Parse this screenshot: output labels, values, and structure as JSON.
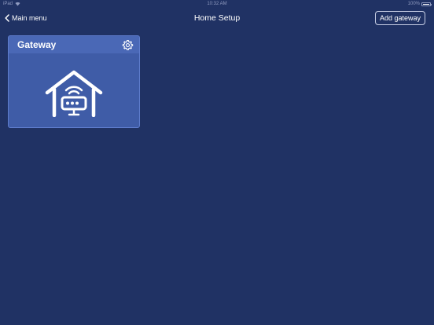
{
  "status_bar": {
    "device": "iPad",
    "time": "10:32 AM",
    "battery": "100%",
    "battery_level": 1.0
  },
  "nav": {
    "back_label": "Main menu",
    "title": "Home Setup",
    "add_gateway_label": "Add gateway"
  },
  "gateways": [
    {
      "name": "Gateway",
      "icon": "home-gateway-icon"
    }
  ],
  "colors": {
    "background": "#203264",
    "card": "#3f5ca7",
    "card_header": "#4a68b6",
    "text": "#ffffff"
  }
}
